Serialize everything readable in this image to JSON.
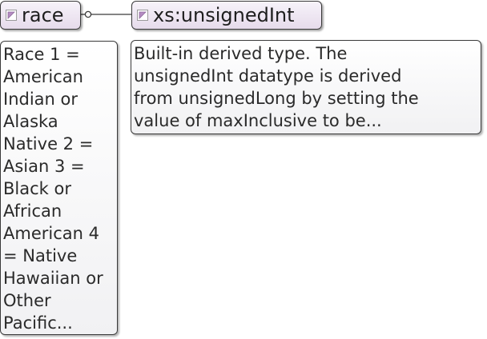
{
  "element": {
    "name": "race",
    "icon": "simple-type-icon",
    "documentation": "Race 1 = American Indian or Alaska Native 2 = Asian 3 = Black or African American 4 = Native Hawaiian or Other Pacific..."
  },
  "type": {
    "name": "xs:unsignedInt",
    "icon": "simple-type-icon",
    "documentation": "Built-in derived type. The\nunsignedInt datatype is derived\nfrom unsignedLong by setting the\nvalue of maxInclusive to be..."
  },
  "colors": {
    "node_fill_top": "#f7f3fa",
    "node_fill_bottom": "#e6dbeb",
    "border": "#3a3a3a",
    "icon_accent": "#a57ab3"
  }
}
